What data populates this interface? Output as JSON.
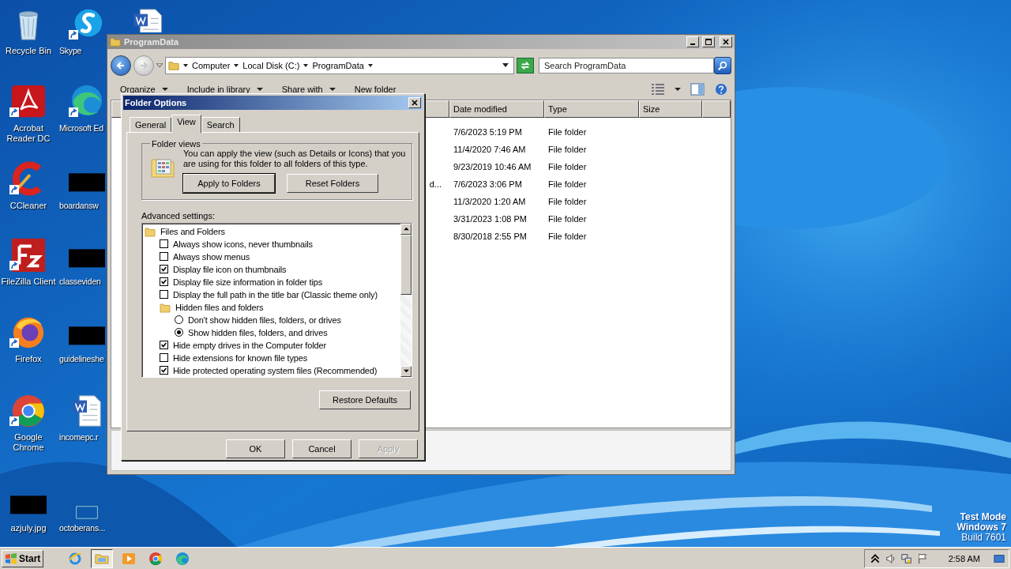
{
  "desktop": {
    "icons": [
      {
        "kind": "recycle",
        "label": "Recycle Bin"
      },
      {
        "kind": "skype",
        "label": "Skype"
      },
      {
        "kind": "word"
      },
      {
        "kind": "acrobat",
        "label": "Acrobat Reader DC"
      },
      {
        "kind": "edge",
        "label": "Microsoft Ed"
      },
      {
        "kind": "ccleaner",
        "label": "CCleaner"
      },
      {
        "kind": "redacted",
        "label": "boardansw"
      },
      {
        "kind": "filezilla",
        "label": "FileZilla Client"
      },
      {
        "kind": "redacted",
        "label": "classeviden"
      },
      {
        "kind": "firefox",
        "label": "Firefox"
      },
      {
        "kind": "redacted",
        "label": "guidelineshe"
      },
      {
        "kind": "chrome",
        "label": "Google Chrome"
      },
      {
        "kind": "word",
        "label": "incomepc.r"
      },
      {
        "kind": "redacted",
        "label": "azjuly.jpg"
      },
      {
        "kind": "blank",
        "label": "octoberans..."
      }
    ]
  },
  "explorer": {
    "title": "ProgramData",
    "breadcrumb": [
      "Computer",
      "Local Disk (C:)",
      "ProgramData"
    ],
    "search": {
      "placeholder": "Search ProgramData"
    },
    "toolbar": [
      {
        "label": "Organize",
        "menu": true
      },
      {
        "label": "Include in library",
        "menu": true
      },
      {
        "label": "Share with",
        "menu": true
      },
      {
        "label": "New folder",
        "menu": false
      }
    ],
    "columns": [
      "Date modified",
      "Type",
      "Size"
    ],
    "rows": [
      {
        "date": "7/6/2023 5:19 PM",
        "type": "File folder"
      },
      {
        "date": "11/4/2020 7:46 AM",
        "type": "File folder"
      },
      {
        "date": "9/23/2019 10:46 AM",
        "type": "File folder"
      },
      {
        "name": "d...",
        "date": "7/6/2023 3:06 PM",
        "type": "File folder"
      },
      {
        "date": "11/3/2020 1:20 AM",
        "type": "File folder"
      },
      {
        "date": "3/31/2023 1:08 PM",
        "type": "File folder"
      },
      {
        "date": "8/30/2018 2:55 PM",
        "type": "File folder"
      }
    ]
  },
  "dialog": {
    "title": "Folder Options",
    "tabs": [
      {
        "label": "General",
        "selected": false
      },
      {
        "label": "View",
        "selected": true
      },
      {
        "label": "Search",
        "selected": false
      }
    ],
    "folder_views": {
      "legend": "Folder views",
      "text": "You can apply the view (such as Details or Icons) that you are using for this folder to all folders of this type.",
      "buttons": [
        {
          "label": "Apply to Folders",
          "default": true
        },
        {
          "label": "Reset Folders",
          "default": false
        }
      ]
    },
    "advanced_label": "Advanced settings:",
    "settings": [
      {
        "kind": "group",
        "label": "Files and Folders",
        "children": [
          {
            "kind": "checkbox",
            "label": "Always show icons, never thumbnails",
            "checked": false
          },
          {
            "kind": "checkbox",
            "label": "Always show menus",
            "checked": false
          },
          {
            "kind": "checkbox",
            "label": "Display file icon on thumbnails",
            "checked": true
          },
          {
            "kind": "checkbox",
            "label": "Display file size information in folder tips",
            "checked": true
          },
          {
            "kind": "checkbox",
            "label": "Display the full path in the title bar (Classic theme only)",
            "checked": false
          },
          {
            "kind": "group",
            "label": "Hidden files and folders",
            "children": [
              {
                "kind": "radio",
                "label": "Don't show hidden files, folders, or drives",
                "selected": false
              },
              {
                "kind": "radio",
                "label": "Show hidden files, folders, and drives",
                "selected": true
              }
            ]
          },
          {
            "kind": "checkbox",
            "label": "Hide empty drives in the Computer folder",
            "checked": true
          },
          {
            "kind": "checkbox",
            "label": "Hide extensions for known file types",
            "checked": false
          },
          {
            "kind": "checkbox",
            "label": "Hide protected operating system files (Recommended)",
            "checked": true
          }
        ]
      }
    ],
    "restore_button": "Restore Defaults",
    "buttons": [
      {
        "label": "OK",
        "disabled": false
      },
      {
        "label": "Cancel",
        "disabled": false
      },
      {
        "label": "Apply",
        "disabled": true
      }
    ]
  },
  "taskbar": {
    "start": "Start",
    "apps": [
      {
        "kind": "ie",
        "selected": false
      },
      {
        "kind": "explorer",
        "selected": true
      },
      {
        "kind": "media",
        "selected": false
      },
      {
        "kind": "chrome",
        "selected": false
      },
      {
        "kind": "edge",
        "selected": false
      }
    ],
    "clock": "2:58 AM"
  },
  "system_note": [
    "Test Mode",
    "Windows 7",
    "Build 7601"
  ]
}
